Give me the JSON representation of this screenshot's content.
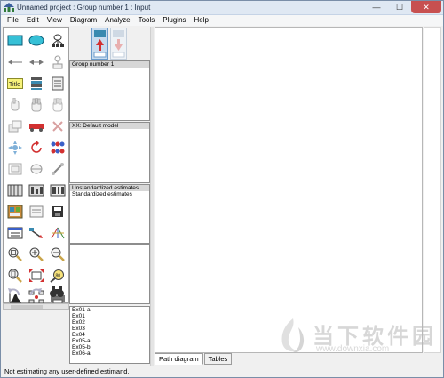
{
  "window": {
    "title": "Unnamed project : Group number 1 : Input",
    "controls": {
      "minimize": "—",
      "maximize": "☐",
      "close": "✕"
    }
  },
  "menu": [
    "File",
    "Edit",
    "View",
    "Diagram",
    "Analyze",
    "Tools",
    "Plugins",
    "Help"
  ],
  "palette": {
    "tools": [
      "rectangle-icon",
      "ellipse-icon",
      "indicator-latent-icon",
      "arrow-left-icon",
      "double-arrow-icon",
      "unique-variable-icon",
      "title-icon",
      "list-variables-icon",
      "list-data-icon",
      "select-one-icon",
      "select-all-icon",
      "deselect-all-icon",
      "duplicate-icon",
      "move-icon",
      "erase-icon",
      "move-parameter-icon",
      "rotate-icon",
      "reflect-icon",
      "shape-icon",
      "touch-up-icon",
      "preserve-symmetry-icon",
      "data-files-icon",
      "analysis-properties-icon",
      "calculate-estimates-icon",
      "view-text-icon",
      "copy-icon",
      "save-icon",
      "object-properties-icon",
      "drag-properties-icon",
      "bayesian-icon",
      "zoom-area-icon",
      "zoom-in-icon",
      "zoom-out-icon",
      "page-view-icon",
      "fit-page-icon",
      "loupe-icon",
      "degrees-of-freedom-icon",
      "link-objects-icon",
      "print-icon",
      "undo-icon",
      "redo-icon",
      "specification-search-icon"
    ]
  },
  "model_buttons": {
    "input": "view-input-path-diagram-icon",
    "output": "view-output-path-diagram-icon"
  },
  "panels": {
    "groups": [
      "Group number 1"
    ],
    "models": [
      "XX: Default model"
    ],
    "estimates": [
      "Unstandardized estimates",
      "Standardized estimates"
    ],
    "variables": [
      "Ex01-a",
      "Ex01",
      "Ex02",
      "Ex03",
      "Ex04",
      "Ex05-a",
      "Ex05-b",
      "Ex06-a"
    ]
  },
  "tabs": [
    "Path diagram",
    "Tables"
  ],
  "status": "Not estimating any user-defined estimand.",
  "watermark": {
    "main": "当下软件园",
    "url": "www.downxia.com"
  },
  "colors": {
    "title_bar": "#dfe8f3",
    "close_button": "#c75050",
    "selected_model_button": "#c9dcef"
  }
}
